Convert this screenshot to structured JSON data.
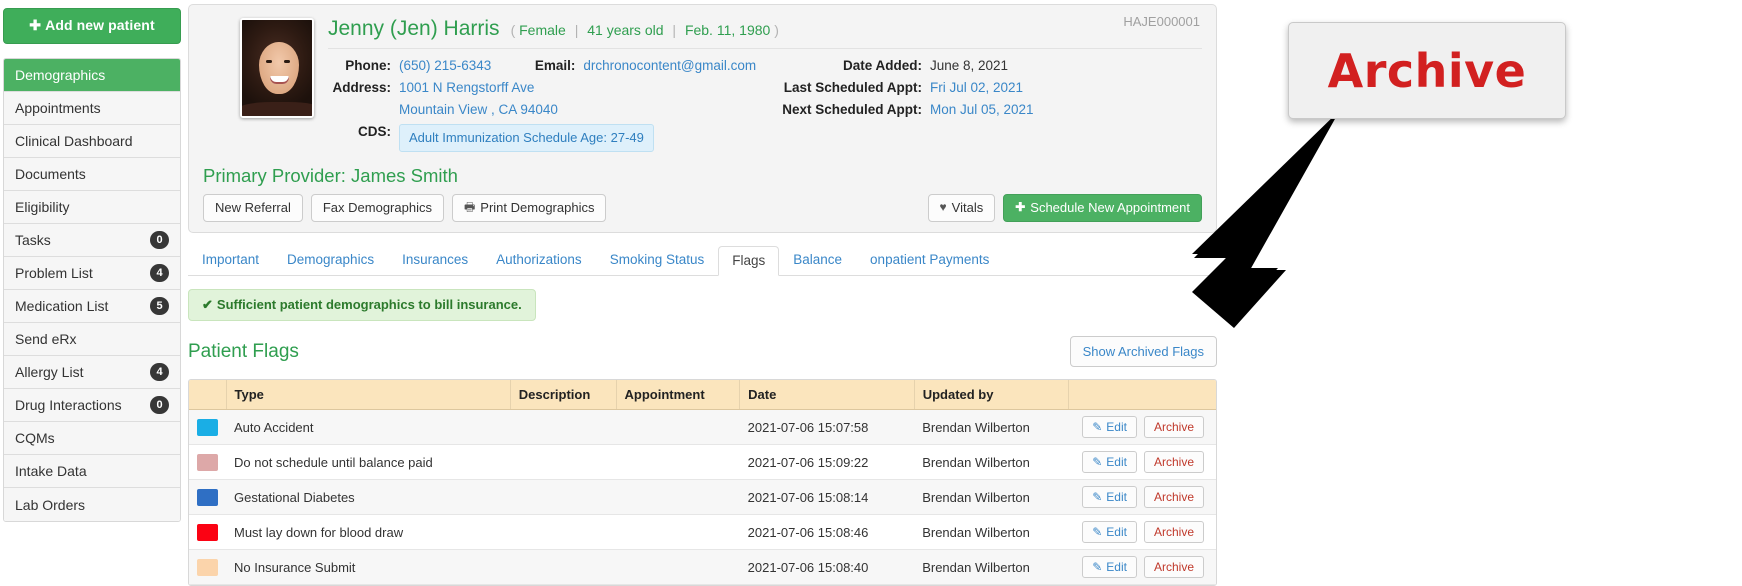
{
  "sidebar": {
    "add_patient_label": "Add new patient",
    "add_icon": "plus-icon",
    "items": [
      {
        "label": "Demographics",
        "badge": null,
        "active": true
      },
      {
        "label": "Appointments",
        "badge": null,
        "active": false
      },
      {
        "label": "Clinical Dashboard",
        "badge": null,
        "active": false
      },
      {
        "label": "Documents",
        "badge": null,
        "active": false
      },
      {
        "label": "Eligibility",
        "badge": null,
        "active": false
      },
      {
        "label": "Tasks",
        "badge": "0",
        "active": false
      },
      {
        "label": "Problem List",
        "badge": "4",
        "active": false
      },
      {
        "label": "Medication List",
        "badge": "5",
        "active": false
      },
      {
        "label": "Send eRx",
        "badge": null,
        "active": false
      },
      {
        "label": "Allergy List",
        "badge": "4",
        "active": false
      },
      {
        "label": "Drug Interactions",
        "badge": "0",
        "active": false
      },
      {
        "label": "CQMs",
        "badge": null,
        "active": false
      },
      {
        "label": "Intake Data",
        "badge": null,
        "active": false
      },
      {
        "label": "Lab Orders",
        "badge": null,
        "active": false
      }
    ]
  },
  "patient": {
    "id": "HAJE000001",
    "name": "Jenny (Jen) Harris",
    "paren_open": "(",
    "paren_close": ")",
    "sex": "Female",
    "age": "41 years old",
    "dob": "Feb. 11, 1980",
    "phone_label": "Phone:",
    "phone": "(650) 215-6343",
    "email_label": "Email:",
    "email": "drchronocontent@gmail.com",
    "address_label": "Address:",
    "address_line1": "1001 N Rengstorff Ave",
    "address_line2": "Mountain View , CA 94040",
    "cds_label": "CDS:",
    "cds_value": "Adult Immunization Schedule Age: 27-49",
    "date_added_label": "Date Added:",
    "date_added": "June 8, 2021",
    "last_appt_label": "Last Scheduled Appt:",
    "last_appt": "Fri Jul 02, 2021",
    "next_appt_label": "Next Scheduled Appt:",
    "next_appt": "Mon Jul 05, 2021",
    "provider": "Primary Provider: James Smith"
  },
  "actions": {
    "new_referral": "New Referral",
    "fax_demographics": "Fax Demographics",
    "print_demographics": "Print Demographics",
    "print_icon": "printer-icon",
    "vitals": "Vitals",
    "vitals_icon": "heart-icon",
    "schedule_appt": "Schedule New Appointment",
    "schedule_icon": "plus-icon"
  },
  "tabs": [
    {
      "label": "Important",
      "active": false
    },
    {
      "label": "Demographics",
      "active": false
    },
    {
      "label": "Insurances",
      "active": false
    },
    {
      "label": "Authorizations",
      "active": false
    },
    {
      "label": "Smoking Status",
      "active": false
    },
    {
      "label": "Flags",
      "active": true
    },
    {
      "label": "Balance",
      "active": false
    },
    {
      "label": "onpatient Payments",
      "active": false
    }
  ],
  "alert": {
    "icon": "check-icon",
    "text": "Sufficient patient demographics to bill insurance."
  },
  "flags_section": {
    "title": "Patient Flags",
    "show_archived_label": "Show Archived Flags",
    "columns": [
      "",
      "Type",
      "Description",
      "Appointment",
      "Date",
      "Updated by",
      ""
    ],
    "edit_label": "Edit",
    "edit_icon": "pencil-icon",
    "archive_label": "Archive",
    "rows": [
      {
        "color": "#1aaee5",
        "type": "Auto Accident",
        "description": "",
        "appointment": "",
        "date": "2021-07-06 15:07:58",
        "updated_by": "Brendan Wilberton"
      },
      {
        "color": "#dda8a8",
        "type": "Do not schedule until balance paid",
        "description": "",
        "appointment": "",
        "date": "2021-07-06 15:09:22",
        "updated_by": "Brendan Wilberton"
      },
      {
        "color": "#2f6fc4",
        "type": "Gestational Diabetes",
        "description": "",
        "appointment": "",
        "date": "2021-07-06 15:08:14",
        "updated_by": "Brendan Wilberton"
      },
      {
        "color": "#fb0213",
        "type": "Must lay down for blood draw",
        "description": "",
        "appointment": "",
        "date": "2021-07-06 15:08:46",
        "updated_by": "Brendan Wilberton"
      },
      {
        "color": "#fbd4ab",
        "type": "No Insurance Submit",
        "description": "",
        "appointment": "",
        "date": "2021-07-06 15:08:40",
        "updated_by": "Brendan Wilberton"
      }
    ]
  },
  "annotation": {
    "callout_text": "Archive",
    "callout_color": "#d22020",
    "arrow_icon": "arrow-pointer-icon"
  }
}
